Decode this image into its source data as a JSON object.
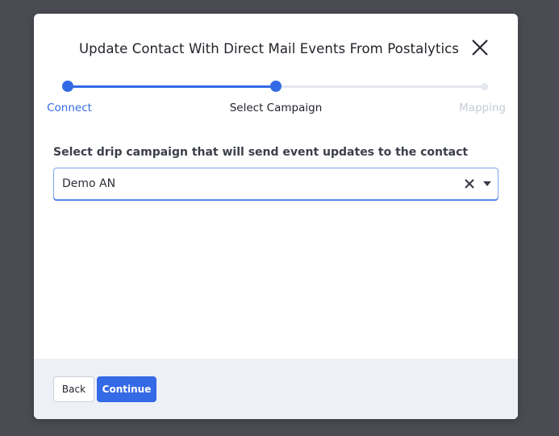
{
  "modal": {
    "title": "Update Contact With Direct Mail Events From Postalytics"
  },
  "stepper": {
    "steps": [
      {
        "label": "Connect",
        "state": "done"
      },
      {
        "label": "Select Campaign",
        "state": "current"
      },
      {
        "label": "Mapping",
        "state": "future"
      }
    ]
  },
  "form": {
    "label": "Select drip campaign that will send event updates to the contact",
    "selected_value": "Demo AN"
  },
  "footer": {
    "back_label": "Back",
    "continue_label": "Continue"
  },
  "colors": {
    "accent": "#356ae6",
    "footer_bg": "#eef0f7",
    "backdrop": "#4b4b53"
  },
  "icons": {
    "close": "close-icon",
    "clear": "clear-icon",
    "dropdown": "chevron-down-icon"
  }
}
